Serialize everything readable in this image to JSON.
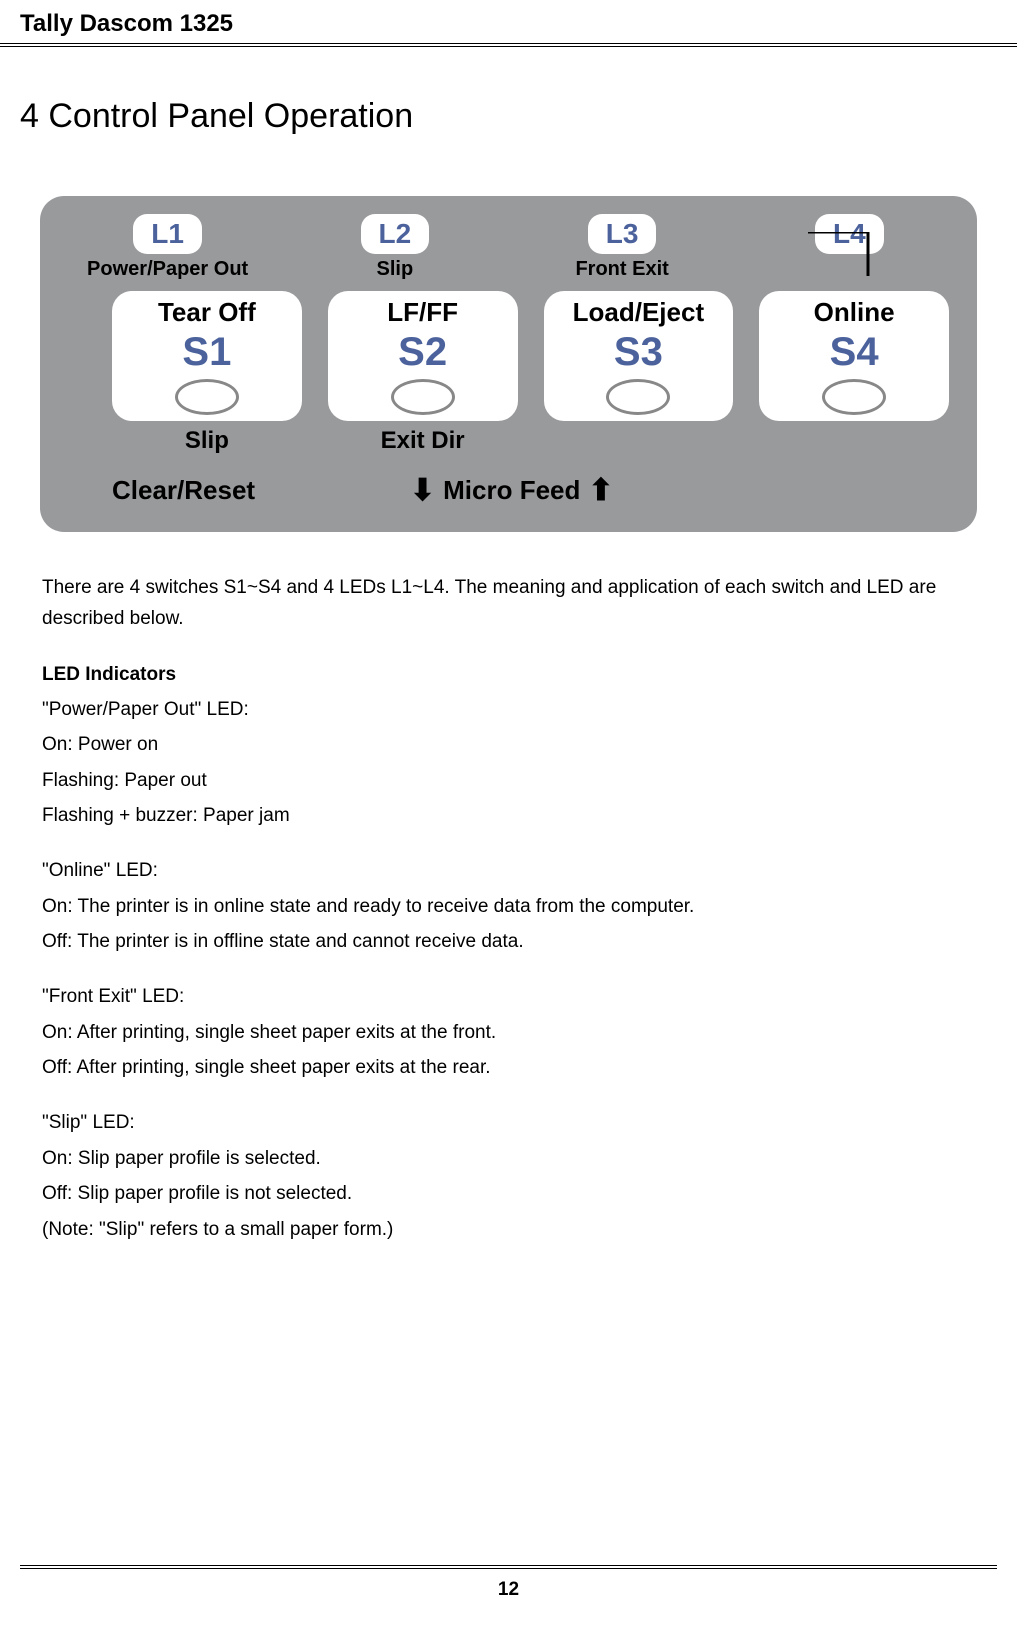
{
  "header": {
    "title": "Tally Dascom 1325"
  },
  "section": {
    "title": "4 Control Panel Operation"
  },
  "panel": {
    "leds": [
      {
        "id": "L1",
        "label": "Power/Paper Out"
      },
      {
        "id": "L2",
        "label": "Slip"
      },
      {
        "id": "L3",
        "label": "Front Exit"
      },
      {
        "id": "L4",
        "label": ""
      }
    ],
    "switches": [
      {
        "top": "Tear Off",
        "s": "S1",
        "sub": "Slip"
      },
      {
        "top": "LF/FF",
        "s": "S2",
        "sub": "Exit Dir"
      },
      {
        "top": "Load/Eject",
        "s": "S3",
        "sub": ""
      },
      {
        "top": "Online",
        "s": "S4",
        "sub": ""
      }
    ],
    "bottom": {
      "left": "Clear/Reset",
      "micro": "Micro Feed"
    }
  },
  "content": {
    "intro": "There are 4 switches S1~S4 and 4 LEDs L1~L4. The meaning and application of each switch and LED are described below.",
    "led_heading": "LED Indicators",
    "power_led": {
      "title": "\"Power/Paper Out\" LED:",
      "l1": "On: Power on",
      "l2": "Flashing: Paper out",
      "l3": "Flashing + buzzer: Paper jam"
    },
    "online_led": {
      "title": "\"Online\" LED:",
      "l1": "On: The printer is in online state and ready to receive data from the computer.",
      "l2": "Off: The printer is in offline state and cannot receive data."
    },
    "front_led": {
      "title": "\"Front Exit\" LED:",
      "l1": "On: After printing, single sheet paper exits at the front.",
      "l2": "Off: After printing, single sheet paper exits at the rear."
    },
    "slip_led": {
      "title": "\"Slip\" LED:",
      "l1": "On: Slip paper profile is selected.",
      "l2": "Off: Slip paper profile is not selected.",
      "l3": "(Note: \"Slip\" refers to a small paper form.)"
    }
  },
  "footer": {
    "page": "12"
  }
}
